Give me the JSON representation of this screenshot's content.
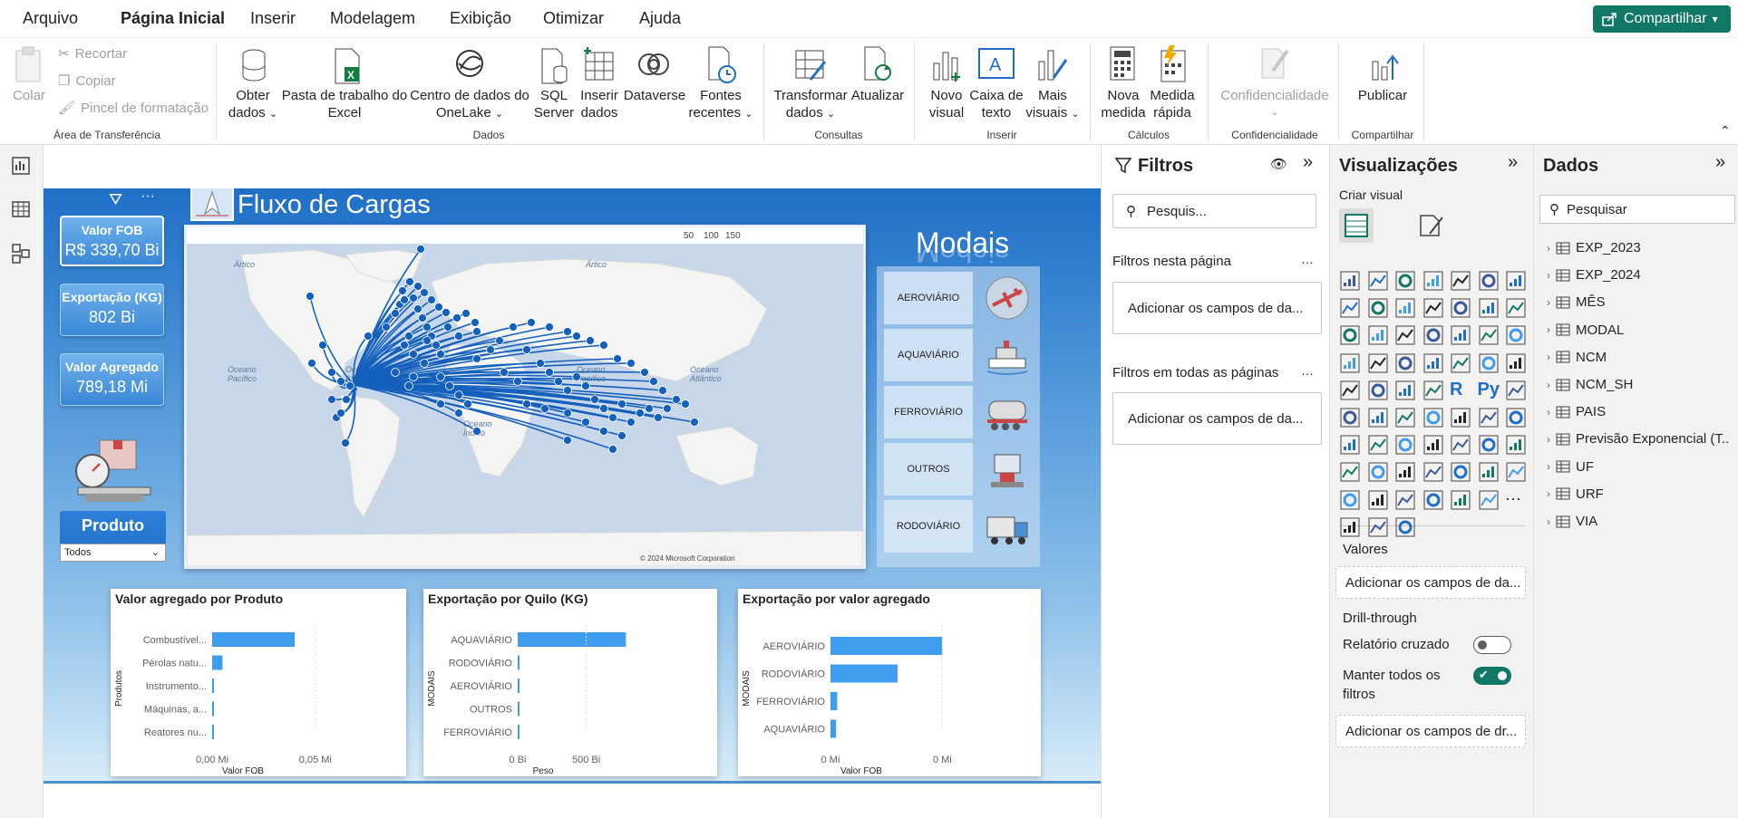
{
  "menu": {
    "items": [
      "Arquivo",
      "Página Inicial",
      "Inserir",
      "Modelagem",
      "Exibição",
      "Otimizar",
      "Ajuda"
    ],
    "share": "Compartilhar"
  },
  "ribbon": {
    "clipboard": {
      "paste": "Colar",
      "cut": "Recortar",
      "copy": "Copiar",
      "format_painter": "Pincel de formatação",
      "group": "Área de Transferência"
    },
    "data": {
      "get_data_1": "Obter",
      "get_data_2": "dados",
      "excel_1": "Pasta de trabalho do",
      "excel_2": "Excel",
      "onelake_1": "Centro de dados do",
      "onelake_2": "OneLake",
      "sql_1": "SQL",
      "sql_2": "Server",
      "enter_1": "Inserir",
      "enter_2": "dados",
      "dataverse": "Dataverse",
      "recent_1": "Fontes",
      "recent_2": "recentes",
      "group": "Dados"
    },
    "queries": {
      "transform_1": "Transformar",
      "transform_2": "dados",
      "refresh": "Atualizar",
      "group": "Consultas"
    },
    "insert": {
      "newvisual_1": "Novo",
      "newvisual_2": "visual",
      "textbox_1": "Caixa de",
      "textbox_2": "texto",
      "more_1": "Mais",
      "more_2": "visuais",
      "group": "Inserir"
    },
    "calc": {
      "measure_1": "Nova",
      "measure_2": "medida",
      "quick_1": "Medida",
      "quick_2": "rápida",
      "group": "Cálculos"
    },
    "sensitivity": {
      "label": "Confidencialidade",
      "group": "Confidencialidade"
    },
    "share": {
      "publish": "Publicar",
      "group": "Compartilhar"
    }
  },
  "report": {
    "title": "Fluxo de Cargas",
    "kpis": [
      {
        "label": "Valor FOB",
        "value": "R$ 339,70 Bi"
      },
      {
        "label": "Exportação (KG)",
        "value": "802 Bi"
      },
      {
        "label": "Valor Agregado",
        "value": "789,18 Mi"
      }
    ],
    "product_slicer": {
      "title": "Produto",
      "value": "Todos"
    },
    "map": {
      "zoom_labels": [
        "50",
        "100",
        "150"
      ],
      "ocean_labels": [
        "Ártico",
        "Ártico",
        "Oceano Pacífico",
        "Oceano Atlântico",
        "Oceano Índico",
        "Oceano Pacífico",
        "Oceano Atlântico"
      ],
      "copyright": "© 2024 Microsoft Corporation"
    },
    "modais": {
      "title": "Modais",
      "items": [
        "AEROVIÁRIO",
        "AQUAVIÁRIO",
        "FERROVIÁRIO",
        "OUTROS",
        "RODOVIÁRIO"
      ]
    }
  },
  "chart_data": [
    {
      "type": "bar",
      "title": "Valor agregado por Produto",
      "ylabel": "Produtos",
      "xlabel": "Valor FOB",
      "categories": [
        "Combustível...",
        "Pérolas natu...",
        "Instrumento...",
        "Máquinas, a...",
        "Reatores nu..."
      ],
      "values": [
        0.04,
        0.005,
        0.0006,
        0.0004,
        0.0002
      ],
      "xticks": [
        "0,00 Mi",
        "0,05 Mi"
      ],
      "xlim": [
        0,
        0.065
      ]
    },
    {
      "type": "bar",
      "title": "Exportação por Quilo (KG)",
      "ylabel": "MODAIS",
      "xlabel": "Peso",
      "categories": [
        "AQUAVIÁRIO",
        "RODOVIÁRIO",
        "AEROVIÁRIO",
        "OUTROS",
        "FERROVIÁRIO"
      ],
      "values": [
        790,
        5,
        1,
        0.5,
        0.3
      ],
      "xticks": [
        "0 Bi",
        "500 Bi"
      ],
      "xlim": [
        0,
        900
      ]
    },
    {
      "type": "bar",
      "title": "Exportação por valor agregado",
      "ylabel": "MODAIS",
      "xlabel": "Valor FOB",
      "categories": [
        "AEROVIÁRIO",
        "RODOVIÁRIO",
        "FERROVIÁRIO",
        "AQUAVIÁRIO"
      ],
      "values": [
        1.0,
        0.6,
        0.06,
        0.05
      ],
      "xticks": [
        "0 Mi",
        "0 Mi"
      ],
      "xlim": [
        0,
        1.2
      ]
    }
  ],
  "filters": {
    "title": "Filtros",
    "search": "Pesquis...",
    "this_page": "Filtros nesta página",
    "add_fields": "Adicionar os campos de da...",
    "all_pages": "Filtros em todas as páginas",
    "add_fields2": "Adicionar os campos de da..."
  },
  "viz": {
    "title": "Visualizações",
    "create": "Criar visual",
    "values": "Valores",
    "add_values": "Adicionar os campos de da...",
    "drill": "Drill-through",
    "cross": "Relatório cruzado",
    "keep_1": "Manter todos os",
    "keep_2": "filtros",
    "add_drill": "Adicionar os campos de dr...",
    "r_label": "R",
    "py_label": "Py"
  },
  "data": {
    "title": "Dados",
    "search": "Pesquisar",
    "tables": [
      "EXP_2023",
      "EXP_2024",
      "MÊS",
      "MODAL",
      "NCM",
      "NCM_SH",
      "PAIS",
      "Previsão Exponencial (T...",
      "UF",
      "URF",
      "VIA"
    ]
  },
  "colors": {
    "accent": "#117865",
    "bar": "#3f9df0",
    "map_line": "#1560bd"
  }
}
